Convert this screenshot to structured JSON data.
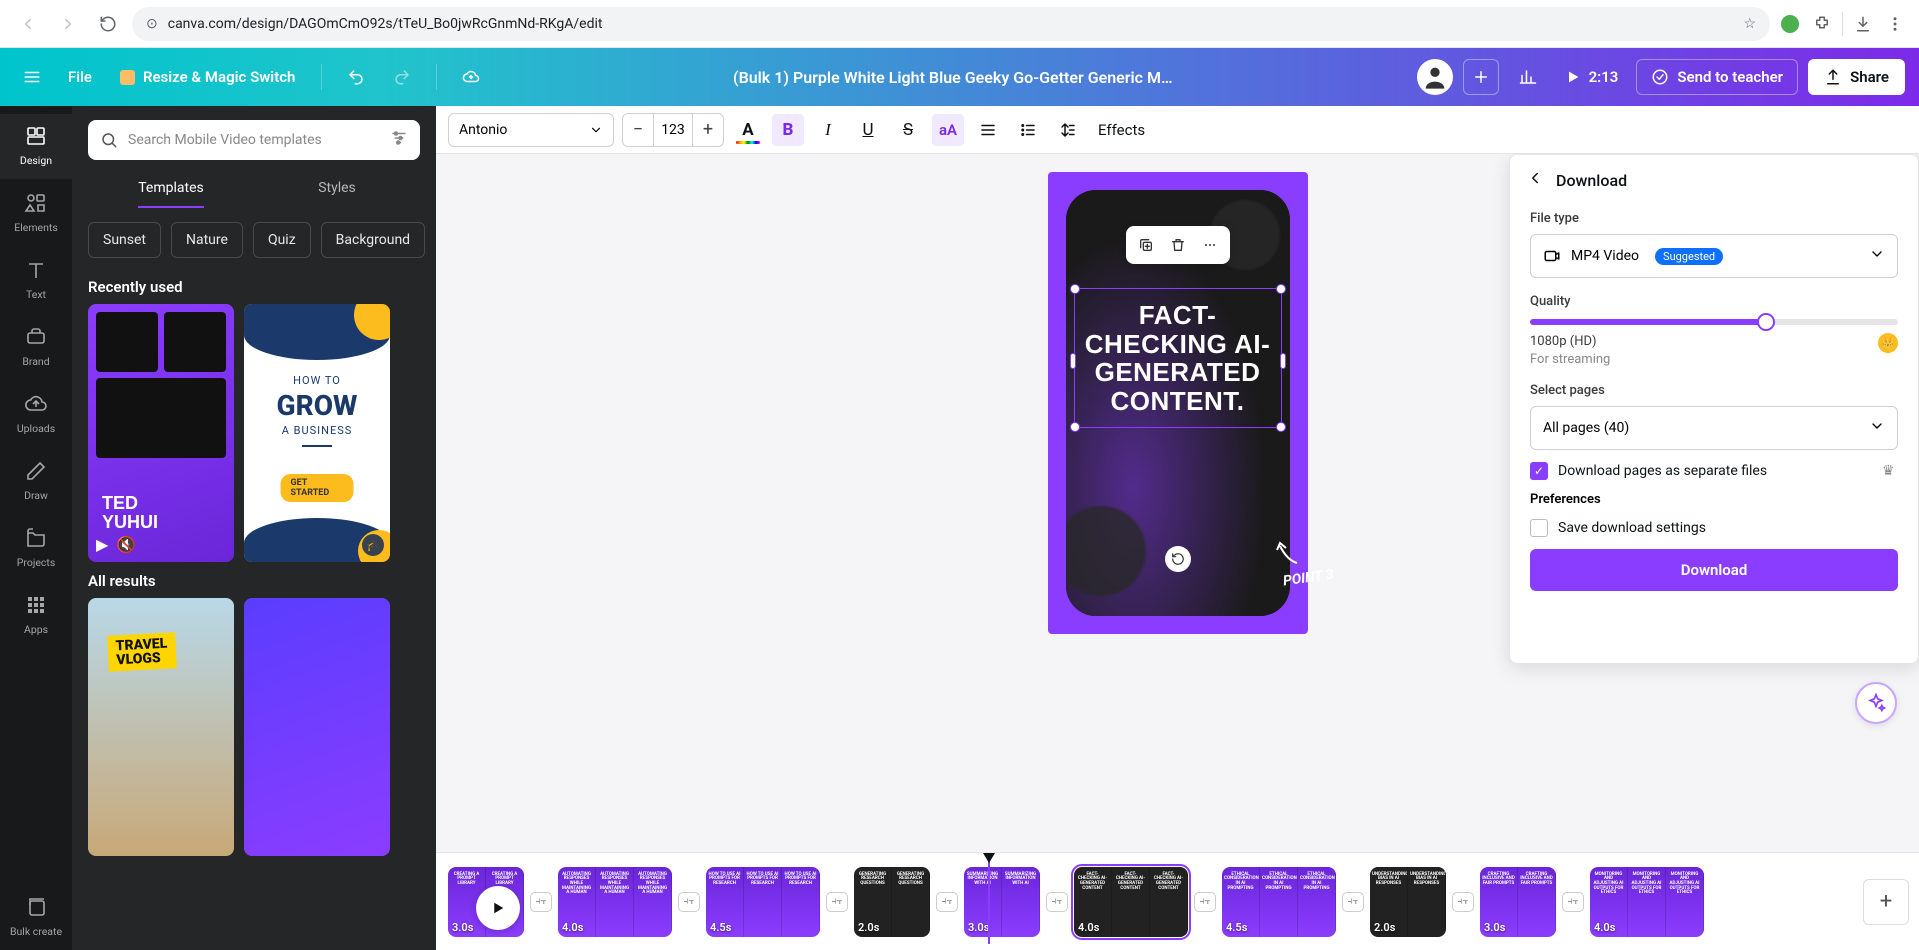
{
  "url": "canva.com/design/DAGOmCmO92s/tTeU_Bo0jwRcGnmNd-RKgA/edit",
  "topbar": {
    "file": "File",
    "resize": "Resize & Magic Switch",
    "title": "(Bulk 1) Purple White Light Blue Geeky Go-Getter Generic M...",
    "time": "2:13",
    "send": "Send to teacher",
    "share": "Share"
  },
  "rail": {
    "design": "Design",
    "elements": "Elements",
    "text": "Text",
    "brand": "Brand",
    "uploads": "Uploads",
    "draw": "Draw",
    "projects": "Projects",
    "apps": "Apps",
    "bulk": "Bulk create"
  },
  "panel": {
    "placeholder": "Search Mobile Video templates",
    "tab_templates": "Templates",
    "tab_styles": "Styles",
    "chips": [
      "Sunset",
      "Nature",
      "Quiz",
      "Background"
    ],
    "recently": "Recently used",
    "all": "All results",
    "ted": "TED\nYUHUI",
    "biz_how": "HOW TO",
    "biz_grow": "GROW",
    "biz_sub": "A BUSINESS",
    "biz_cta": "GET STARTED",
    "travel": "TRAVEL\nVLOGS"
  },
  "toolbar": {
    "font": "Antonio",
    "size": "123",
    "effects": "Effects"
  },
  "canvas": {
    "text": "FACT-CHECKING AI-GENERATED CONTENT.",
    "point": "POINT 3"
  },
  "download": {
    "title": "Download",
    "filetype_label": "File type",
    "mp4": "MP4 Video",
    "suggested": "Suggested",
    "quality_label": "Quality",
    "hd": "1080p (HD)",
    "stream": "For streaming",
    "pages_label": "Select pages",
    "pages": "All pages (40)",
    "sep": "Download pages as separate files",
    "prefs": "Preferences",
    "save": "Save download settings",
    "btn": "Download"
  },
  "timeline": {
    "clips": [
      {
        "dur": "3.0s",
        "frames": 2,
        "text": "CREATING A PROMPT LIBRARY"
      },
      {
        "dur": "4.0s",
        "frames": 3,
        "text": "AUTOMATING RESPONSES WHILE MAINTAINING A HUMAN"
      },
      {
        "dur": "4.5s",
        "frames": 3,
        "text": "HOW TO USE AI PROMPTS FOR RESEARCH"
      },
      {
        "dur": "2.0s",
        "frames": 2,
        "text": "GENERATING RESEARCH QUESTIONS",
        "dark": true
      },
      {
        "dur": "3.0s",
        "frames": 2,
        "text": "SUMMARIZING INFORMATION WITH AI"
      },
      {
        "dur": "4.0s",
        "frames": 3,
        "text": "FACT-CHECKING AI-GENERATED CONTENT",
        "dark": true,
        "selected": true
      },
      {
        "dur": "4.5s",
        "frames": 3,
        "text": "ETHICAL CONSIDERATIONS IN AI PROMPTING"
      },
      {
        "dur": "2.0s",
        "frames": 2,
        "text": "UNDERSTANDING BIAS IN AI RESPONSES",
        "dark": true
      },
      {
        "dur": "3.0s",
        "frames": 2,
        "text": "CRAFTING INCLUSIVE AND FAIR PROMPTS"
      },
      {
        "dur": "4.0s",
        "frames": 3,
        "text": "MONITORING AND ADJUSTING AI OUTPUTS FOR ETHICS"
      }
    ]
  }
}
